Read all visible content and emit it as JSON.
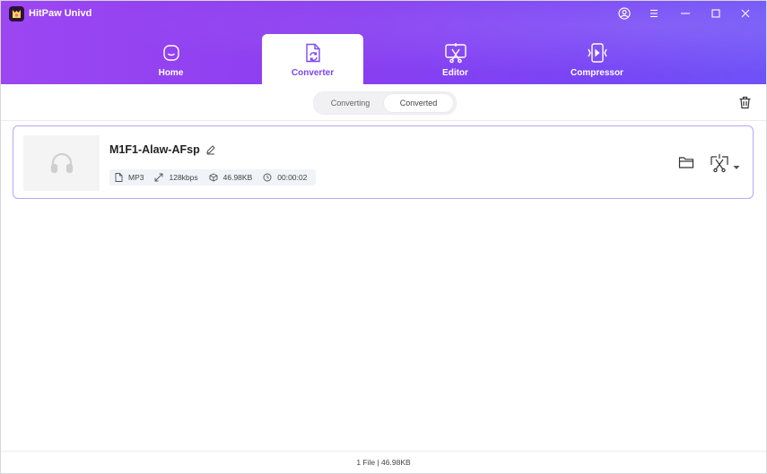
{
  "app": {
    "title": "HitPaw Univd"
  },
  "window_controls": {
    "account_icon": "user-circle-icon",
    "menu_icon": "menu-icon",
    "minimize_icon": "minimize-icon",
    "maximize_icon": "maximize-icon",
    "close_icon": "close-icon"
  },
  "nav": {
    "tabs": [
      {
        "label": "Home",
        "icon": "home-icon",
        "active": false
      },
      {
        "label": "Converter",
        "icon": "converter-icon",
        "active": true
      },
      {
        "label": "Editor",
        "icon": "editor-icon",
        "active": false
      },
      {
        "label": "Compressor",
        "icon": "compressor-icon",
        "active": false
      }
    ]
  },
  "subtabs": {
    "converting": "Converting",
    "converted": "Converted",
    "active": "Converted"
  },
  "file": {
    "name": "M1F1-Alaw-AFsp",
    "format": "MP3",
    "bitrate": "128kbps",
    "size": "46.98KB",
    "duration": "00:00:02"
  },
  "status": {
    "summary": "1 File | 46.98KB"
  },
  "colors": {
    "accent": "#7b45f1",
    "header_start": "#9c46f2",
    "header_end": "#6f52f7",
    "card_border": "#b9a6f5"
  }
}
